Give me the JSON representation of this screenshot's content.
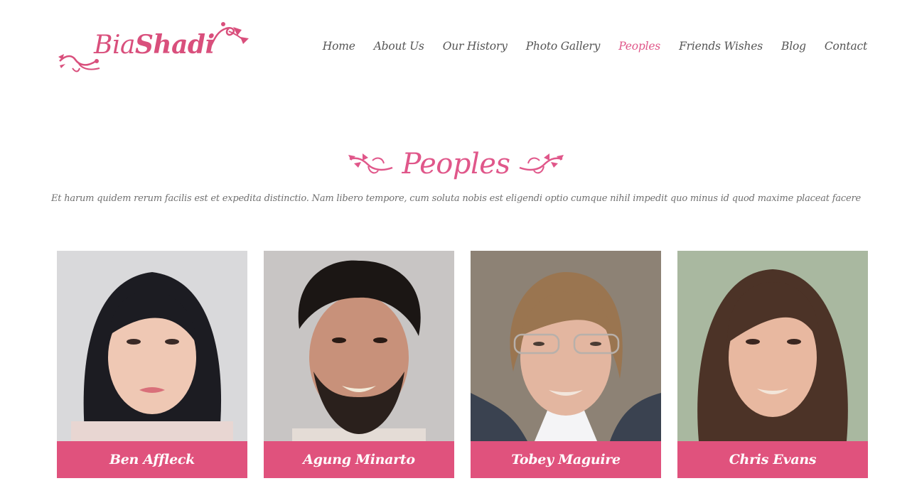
{
  "brand": {
    "name_light": "Bia",
    "name_bold": "Shadi",
    "accent": "#e0578a"
  },
  "nav": {
    "items": [
      {
        "label": "Home",
        "active": false
      },
      {
        "label": "About Us",
        "active": false
      },
      {
        "label": "Our History",
        "active": false
      },
      {
        "label": "Photo Gallery",
        "active": false
      },
      {
        "label": "Peoples",
        "active": true
      },
      {
        "label": "Friends Wishes",
        "active": false
      },
      {
        "label": "Blog",
        "active": false
      },
      {
        "label": "Contact",
        "active": false
      }
    ]
  },
  "section": {
    "title": "Peoples",
    "subtitle": "Et harum quidem rerum facilis est et expedita distinctio. Nam libero tempore, cum soluta nobis est eligendi optio cumque nihil impedit quo minus id quod maxime placeat facere"
  },
  "people": [
    {
      "name": "Ben Affleck"
    },
    {
      "name": "Agung Minarto"
    },
    {
      "name": "Tobey Maguire"
    },
    {
      "name": "Chris Evans"
    }
  ]
}
